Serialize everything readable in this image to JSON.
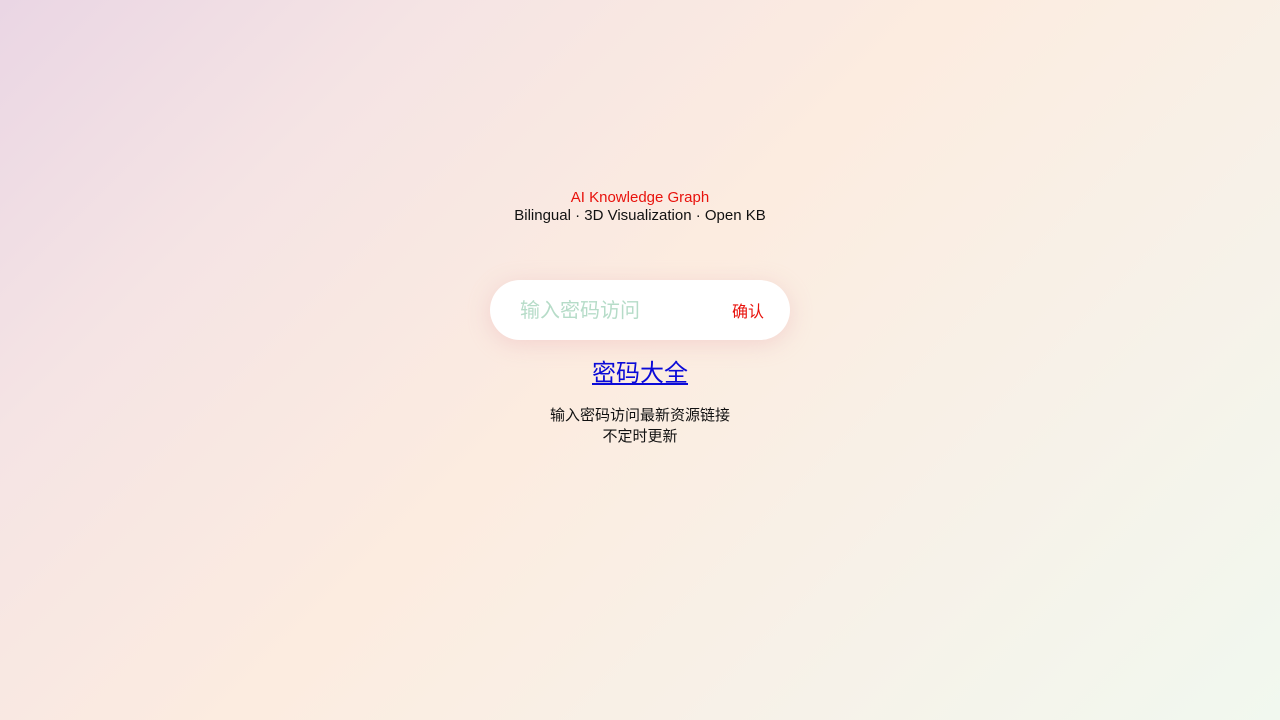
{
  "header": {
    "title": "AI Knowledge Graph",
    "subtitle": "Bilingual · 3D Visualization · Open KB"
  },
  "search": {
    "placeholder": "输入密码访问",
    "value": "",
    "confirm_label": "确认"
  },
  "link": {
    "label": "密码大全"
  },
  "notes": {
    "line1": "输入密码访问最新资源链接",
    "line2": "不定时更新"
  },
  "colors": {
    "accent": "#e8120c",
    "link": "#0b0bd8",
    "placeholder": "#b6dcc8"
  }
}
